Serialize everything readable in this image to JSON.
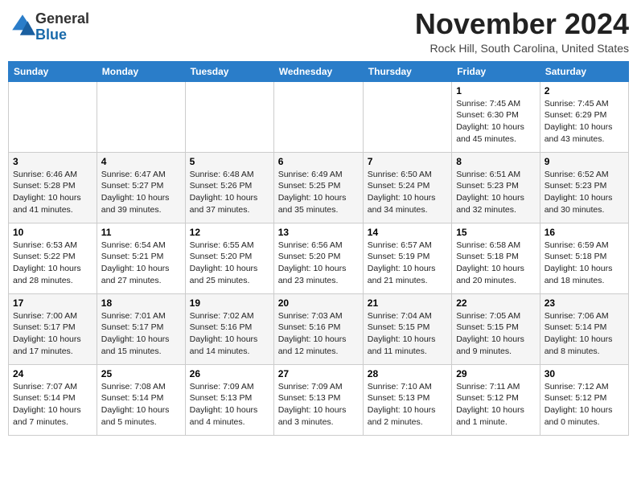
{
  "logo": {
    "general": "General",
    "blue": "Blue"
  },
  "header": {
    "month": "November 2024",
    "location": "Rock Hill, South Carolina, United States"
  },
  "days_of_week": [
    "Sunday",
    "Monday",
    "Tuesday",
    "Wednesday",
    "Thursday",
    "Friday",
    "Saturday"
  ],
  "weeks": [
    [
      {
        "day": "",
        "detail": ""
      },
      {
        "day": "",
        "detail": ""
      },
      {
        "day": "",
        "detail": ""
      },
      {
        "day": "",
        "detail": ""
      },
      {
        "day": "",
        "detail": ""
      },
      {
        "day": "1",
        "detail": "Sunrise: 7:45 AM\nSunset: 6:30 PM\nDaylight: 10 hours and 45 minutes."
      },
      {
        "day": "2",
        "detail": "Sunrise: 7:45 AM\nSunset: 6:29 PM\nDaylight: 10 hours and 43 minutes."
      }
    ],
    [
      {
        "day": "3",
        "detail": "Sunrise: 6:46 AM\nSunset: 5:28 PM\nDaylight: 10 hours and 41 minutes."
      },
      {
        "day": "4",
        "detail": "Sunrise: 6:47 AM\nSunset: 5:27 PM\nDaylight: 10 hours and 39 minutes."
      },
      {
        "day": "5",
        "detail": "Sunrise: 6:48 AM\nSunset: 5:26 PM\nDaylight: 10 hours and 37 minutes."
      },
      {
        "day": "6",
        "detail": "Sunrise: 6:49 AM\nSunset: 5:25 PM\nDaylight: 10 hours and 35 minutes."
      },
      {
        "day": "7",
        "detail": "Sunrise: 6:50 AM\nSunset: 5:24 PM\nDaylight: 10 hours and 34 minutes."
      },
      {
        "day": "8",
        "detail": "Sunrise: 6:51 AM\nSunset: 5:23 PM\nDaylight: 10 hours and 32 minutes."
      },
      {
        "day": "9",
        "detail": "Sunrise: 6:52 AM\nSunset: 5:23 PM\nDaylight: 10 hours and 30 minutes."
      }
    ],
    [
      {
        "day": "10",
        "detail": "Sunrise: 6:53 AM\nSunset: 5:22 PM\nDaylight: 10 hours and 28 minutes."
      },
      {
        "day": "11",
        "detail": "Sunrise: 6:54 AM\nSunset: 5:21 PM\nDaylight: 10 hours and 27 minutes."
      },
      {
        "day": "12",
        "detail": "Sunrise: 6:55 AM\nSunset: 5:20 PM\nDaylight: 10 hours and 25 minutes."
      },
      {
        "day": "13",
        "detail": "Sunrise: 6:56 AM\nSunset: 5:20 PM\nDaylight: 10 hours and 23 minutes."
      },
      {
        "day": "14",
        "detail": "Sunrise: 6:57 AM\nSunset: 5:19 PM\nDaylight: 10 hours and 21 minutes."
      },
      {
        "day": "15",
        "detail": "Sunrise: 6:58 AM\nSunset: 5:18 PM\nDaylight: 10 hours and 20 minutes."
      },
      {
        "day": "16",
        "detail": "Sunrise: 6:59 AM\nSunset: 5:18 PM\nDaylight: 10 hours and 18 minutes."
      }
    ],
    [
      {
        "day": "17",
        "detail": "Sunrise: 7:00 AM\nSunset: 5:17 PM\nDaylight: 10 hours and 17 minutes."
      },
      {
        "day": "18",
        "detail": "Sunrise: 7:01 AM\nSunset: 5:17 PM\nDaylight: 10 hours and 15 minutes."
      },
      {
        "day": "19",
        "detail": "Sunrise: 7:02 AM\nSunset: 5:16 PM\nDaylight: 10 hours and 14 minutes."
      },
      {
        "day": "20",
        "detail": "Sunrise: 7:03 AM\nSunset: 5:16 PM\nDaylight: 10 hours and 12 minutes."
      },
      {
        "day": "21",
        "detail": "Sunrise: 7:04 AM\nSunset: 5:15 PM\nDaylight: 10 hours and 11 minutes."
      },
      {
        "day": "22",
        "detail": "Sunrise: 7:05 AM\nSunset: 5:15 PM\nDaylight: 10 hours and 9 minutes."
      },
      {
        "day": "23",
        "detail": "Sunrise: 7:06 AM\nSunset: 5:14 PM\nDaylight: 10 hours and 8 minutes."
      }
    ],
    [
      {
        "day": "24",
        "detail": "Sunrise: 7:07 AM\nSunset: 5:14 PM\nDaylight: 10 hours and 7 minutes."
      },
      {
        "day": "25",
        "detail": "Sunrise: 7:08 AM\nSunset: 5:14 PM\nDaylight: 10 hours and 5 minutes."
      },
      {
        "day": "26",
        "detail": "Sunrise: 7:09 AM\nSunset: 5:13 PM\nDaylight: 10 hours and 4 minutes."
      },
      {
        "day": "27",
        "detail": "Sunrise: 7:09 AM\nSunset: 5:13 PM\nDaylight: 10 hours and 3 minutes."
      },
      {
        "day": "28",
        "detail": "Sunrise: 7:10 AM\nSunset: 5:13 PM\nDaylight: 10 hours and 2 minutes."
      },
      {
        "day": "29",
        "detail": "Sunrise: 7:11 AM\nSunset: 5:12 PM\nDaylight: 10 hours and 1 minute."
      },
      {
        "day": "30",
        "detail": "Sunrise: 7:12 AM\nSunset: 5:12 PM\nDaylight: 10 hours and 0 minutes."
      }
    ]
  ]
}
